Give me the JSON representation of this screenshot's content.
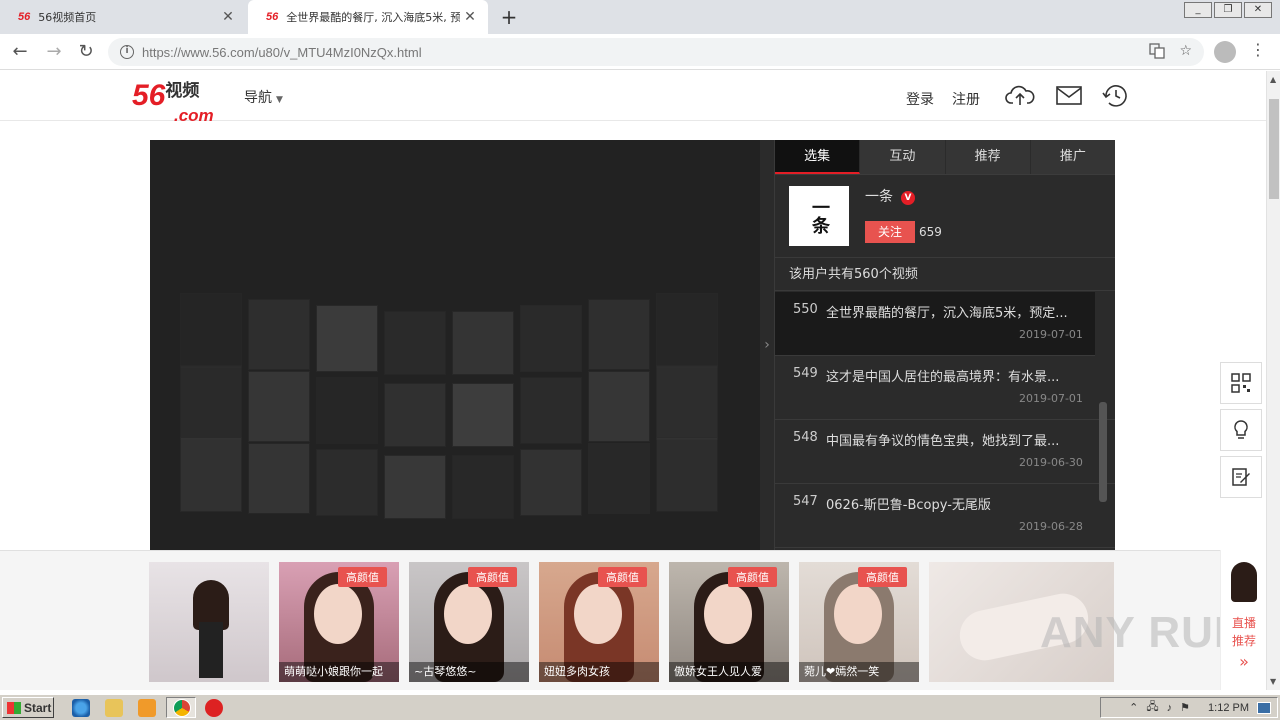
{
  "browser": {
    "tabs": [
      {
        "favicon": "56",
        "title": "56视频首页",
        "active": false
      },
      {
        "favicon": "56",
        "title": "全世界最酷的餐厅, 沉入海底5米, 预",
        "active": true
      }
    ],
    "url_host": "https://www.56.com",
    "url_path": "/u80/v_MTU4MzI0NzQx.html"
  },
  "site": {
    "logo_main": "56",
    "logo_sub": "视频",
    "logo_dotcom": ".com",
    "nav_label": "导航",
    "login_label": "登录",
    "register_label": "注册"
  },
  "panel": {
    "tabs": [
      "选集",
      "互动",
      "推荐",
      "推广"
    ],
    "uploader_avatar_text": "一条",
    "uploader_name": "一条",
    "verified_badge": "V",
    "follow_label": "关注",
    "follower_count": "659",
    "video_count_text": "该用户共有560个视频",
    "videos": [
      {
        "num": "550",
        "title": "全世界最酷的餐厅，沉入海底5米，预定...",
        "date": "2019-07-01"
      },
      {
        "num": "549",
        "title": "这才是中国人居住的最高境界：有水景...",
        "date": "2019-07-01"
      },
      {
        "num": "548",
        "title": "中国最有争议的情色宝典，她找到了最...",
        "date": "2019-06-30"
      },
      {
        "num": "547",
        "title": "0626-斯巴鲁-Bcopy-无尾版",
        "date": "2019-06-28"
      }
    ]
  },
  "ads": {
    "badge": "高颜值",
    "items": [
      {
        "caption": ""
      },
      {
        "caption": "萌萌哒小娘跟你一起"
      },
      {
        "caption": "~古琴悠悠~"
      },
      {
        "caption": "妞妞多肉女孩"
      },
      {
        "caption": "傲娇女王人见人爱"
      },
      {
        "caption": "菀儿❤嫣然一笑"
      },
      {
        "caption": ""
      }
    ],
    "live_label_1": "直播",
    "live_label_2": "推荐",
    "live_arrow": "»"
  },
  "watermark": "ANY RUN",
  "taskbar": {
    "start_label": "Start",
    "clock": "1:12 PM"
  },
  "colors": {
    "brand_red": "#e41e26",
    "panel_bg": "#2b2b2b",
    "player_bg": "#222222"
  }
}
